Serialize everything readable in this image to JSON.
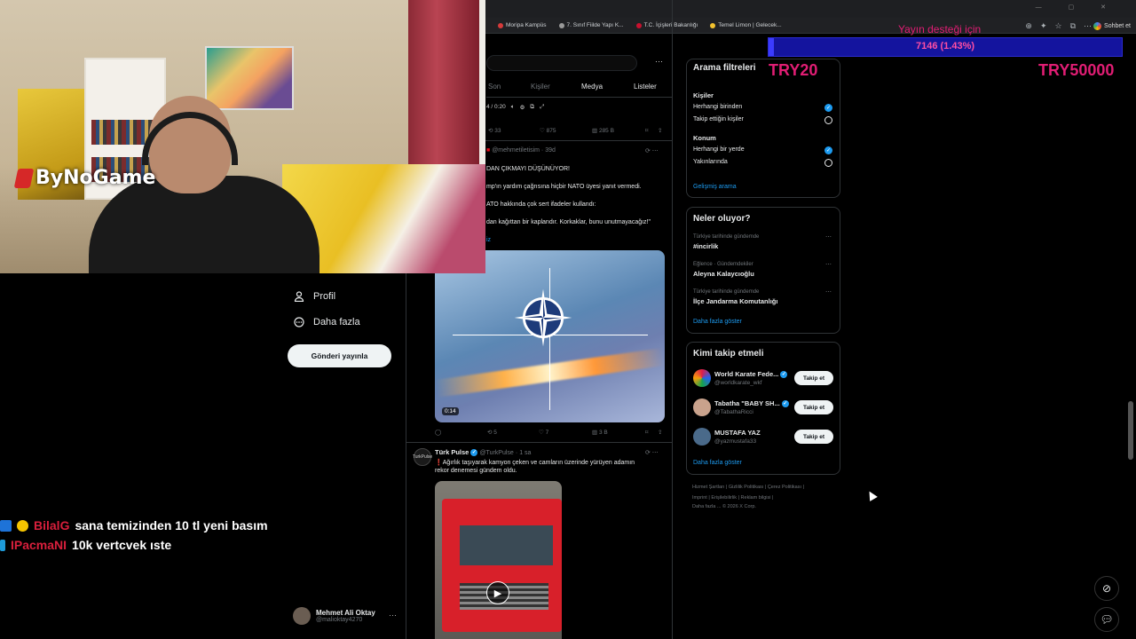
{
  "browser": {
    "bookmarks": [
      "Moripa Kampüs",
      "7. Sınıf Fiilde Yapı K...",
      "T.C. İçişleri Bakanlığı",
      "Temel Limon | Gelecek..."
    ],
    "chat_button": "Sohbet et"
  },
  "stream": {
    "brand": "ByNoGame",
    "donation": {
      "title": "Yayın desteği için",
      "progress_text": "7146 (1.43%)",
      "progress_fraction": 0.0143,
      "min_label": "TRY20",
      "max_label": "TRY50000"
    },
    "chat": [
      {
        "user": "BilalG",
        "message": "sana temizinden 10 tl yeni basım"
      },
      {
        "user": "IPacmaNI",
        "message": "10k vertcvek ıste"
      }
    ]
  },
  "sidebar": {
    "items": [
      {
        "label": "Profil",
        "icon": "person-icon"
      },
      {
        "label": "Daha fazla",
        "icon": "more-circle-icon"
      }
    ],
    "post_button": "Gönderi yayınla",
    "account": {
      "name": "Mehmet Ali Oktay",
      "handle": "@malioktay4270"
    }
  },
  "timeline": {
    "tabs": [
      "Son",
      "Kişiler",
      "Medya",
      "Listeler"
    ],
    "active_tab": "Son",
    "video_time": "4 / 0:20",
    "post1_actions": {
      "replies": "",
      "reposts": "33",
      "likes": "875",
      "views": "285 B"
    },
    "post2": {
      "handle": "@mehmetiletisim",
      "age": "39d",
      "lines": [
        "DAN ÇIKMAYI DÜŞÜNÜYOR!",
        "mp'ın yardım çağrısına hiçbir NATO üyesi yanıt vermedi.",
        "ATO hakkında çok sert ifadeler kullandı:",
        "dan kağıttan bir kaplandır. Korkaklar, bunu unutmayacağız!\""
      ],
      "hashtag": "iz",
      "video_duration": "0:14",
      "reposts": "5",
      "likes": "7",
      "views": "3 B"
    },
    "post3": {
      "name": "Türk Pulse",
      "handle": "@TurkPulse",
      "age": "1 sa",
      "avatar_text": "TurkPulse",
      "lines": [
        "Ağırlık taşıyarak kamyon çeken ve camların üzerinde yürüyen adamın",
        "rekor denemesi gündem oldu."
      ]
    }
  },
  "right": {
    "filters": {
      "title": "Arama filtreleri",
      "people_head": "Kişiler",
      "people_opts": [
        "Herhangi birinden",
        "Takip ettiğin kişiler"
      ],
      "people_selected": 0,
      "location_head": "Konum",
      "location_opts": [
        "Herhangi bir yerde",
        "Yakınlarında"
      ],
      "location_selected": 0,
      "advanced": "Gelişmiş arama"
    },
    "trends": {
      "title": "Neler oluyor?",
      "items": [
        {
          "context": "Türkiye tarihinde gündemde",
          "name": "#incirlik"
        },
        {
          "context": "Eğlence · Gündemdekiler",
          "name": "Aleyna Kalaycıoğlu"
        },
        {
          "context": "Türkiye tarihinde gündemde",
          "name": "İlçe Jandarma Komutanlığı"
        }
      ],
      "show_more": "Daha fazla göster"
    },
    "who_to_follow": {
      "title": "Kimi takip etmeli",
      "items": [
        {
          "name": "World Karate Fede...",
          "handle": "@worldkarate_wkf",
          "verified": true,
          "color": "#f2f2f2"
        },
        {
          "name": "Tabatha \"BABY SH...",
          "handle": "@TabathaRicci",
          "verified": true,
          "color": "#c9a28c"
        },
        {
          "name": "MUSTAFA YAZ",
          "handle": "@yazmustafa33",
          "verified": false,
          "color": "#4a6a8a"
        }
      ],
      "follow_label": "Takip et",
      "show_more": "Daha fazla göster"
    },
    "footer": {
      "line1": [
        "Hizmet Şartları",
        "Gizlilik Politikası",
        "Çerez Politikası"
      ],
      "line2": [
        "Imprint",
        "Erişilebilirlik",
        "Reklam bilgisi"
      ],
      "line3": [
        "Daha fazla ...",
        "© 2026 X Corp."
      ]
    }
  }
}
